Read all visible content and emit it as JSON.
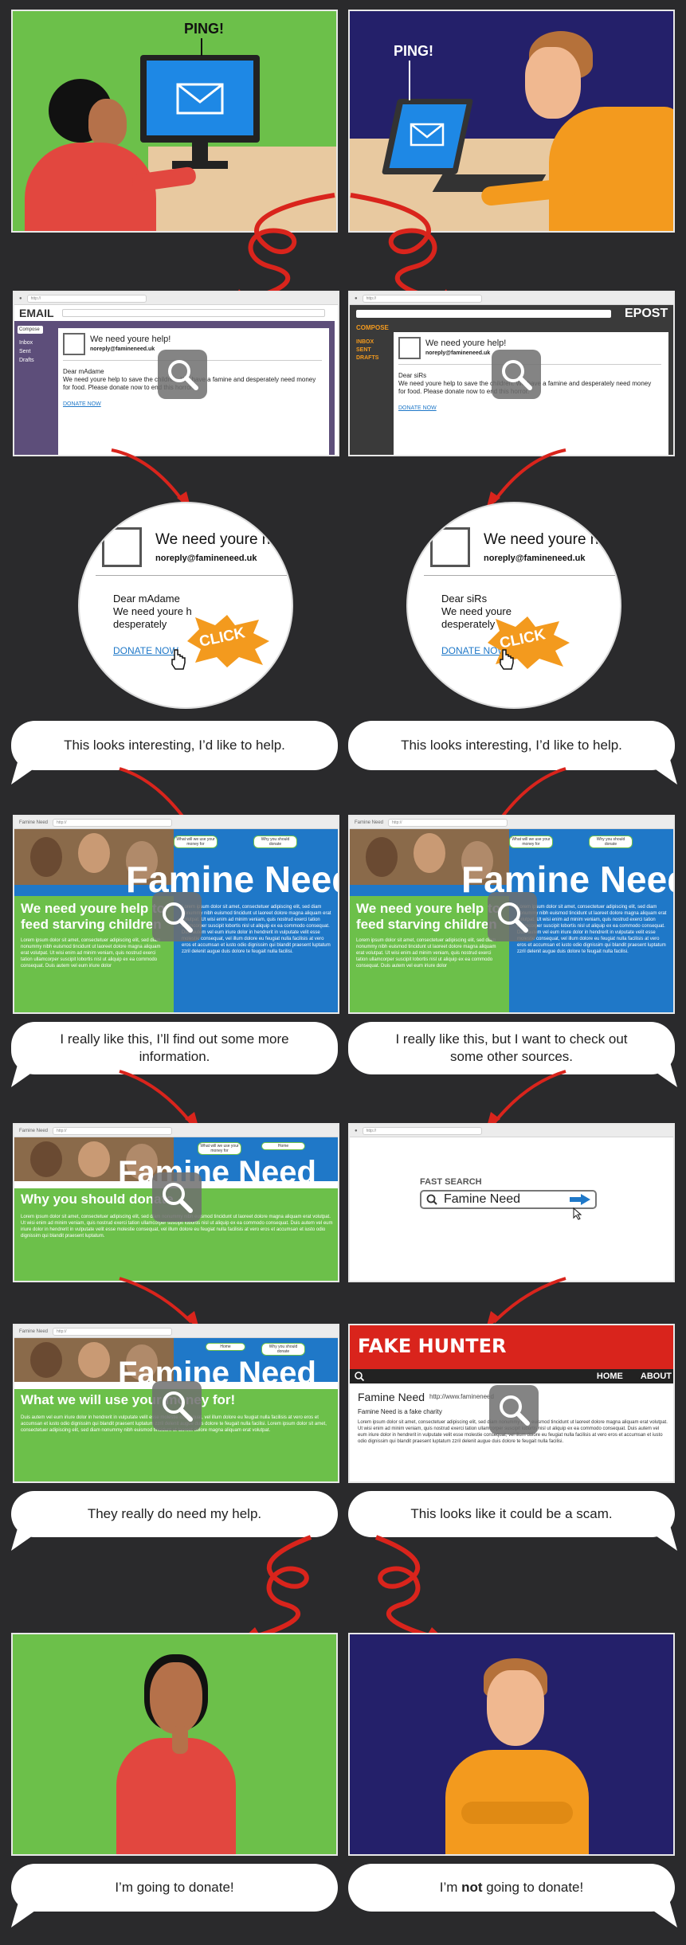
{
  "row1": {
    "left_ping": "PING!",
    "right_ping": "PING!"
  },
  "email_left": {
    "app_name": "EMAIL",
    "compose": "Compose",
    "folders": [
      "Inbox",
      "Sent",
      "Drafts"
    ],
    "subject": "We need youre help!",
    "sender": "noreply@famineneed.uk",
    "greeting": "Dear mAdame",
    "body": "We need youre help to save the children. We have a famine and desperately need money for food. Please donate now to end this horror.",
    "link": "DONATE NOW"
  },
  "email_right": {
    "app_name": "EPOST",
    "compose": "COMPOSE",
    "folders": [
      "INBOX",
      "SENT",
      "DRAFTS"
    ],
    "subject": "We need youre help!",
    "sender": "noreply@famineneed.uk",
    "greeting": "Dear siRs",
    "body": "We need youre help to save the children. We have a famine and desperately need money for food. Please donate now to end this horror.",
    "link": "DONATE NOW"
  },
  "zoom_left": {
    "subject": "We need youre h",
    "sender": "noreply@famineneed.uk",
    "greeting": "Dear mAdame",
    "line1": "We need youre h",
    "line2": "desperately",
    "link": "DONATE NOW",
    "click": "CLICK"
  },
  "zoom_right": {
    "subject": "We need youre h",
    "sender": "noreply@famineneed.uk",
    "greeting": "Dear siRs",
    "line1": "We need youre",
    "line2": "desperately",
    "link": "DONATE NOW",
    "click": "CLICK"
  },
  "bubbles": {
    "b1_left": "This looks interesting, I’d like to help.",
    "b1_right": "This looks interesting, I’d like to help.",
    "b2_left": "I really like this, I’ll find out some more information.",
    "b2_right": "I really like this, but I want to check out some other sources.",
    "b3_left": "They really do need my help.",
    "b3_right": "This looks like it could be a scam.",
    "b4_left": "I’m going to donate!",
    "b4_right_pre": "I’m ",
    "b4_right_bold": "not",
    "b4_right_post": " going to donate!"
  },
  "site": {
    "tab": "Famine Need",
    "brand": "Famine Need",
    "nav_use": "What will we use your money for",
    "nav_donate": "Why you should donate",
    "nav_home": "Home",
    "headline": "We need youre help to feed starving children",
    "why_heading": "Why you should donate",
    "use_heading": "What we will use your money for!"
  },
  "search": {
    "label": "FAST SEARCH",
    "query": "Famine Need"
  },
  "fakehunter": {
    "title": "FAKE HUNTER",
    "nav_home": "HOME",
    "nav_about": "ABOUT",
    "entry_title": "Famine Need",
    "entry_url": "http://www.famineneed",
    "entry_desc": "Famine Need is a fake charity"
  },
  "colors": {
    "green": "#6cc04a",
    "navy": "#24206a",
    "blue": "#1f78c8",
    "red": "#d9241c",
    "orange": "#f39a1e"
  }
}
